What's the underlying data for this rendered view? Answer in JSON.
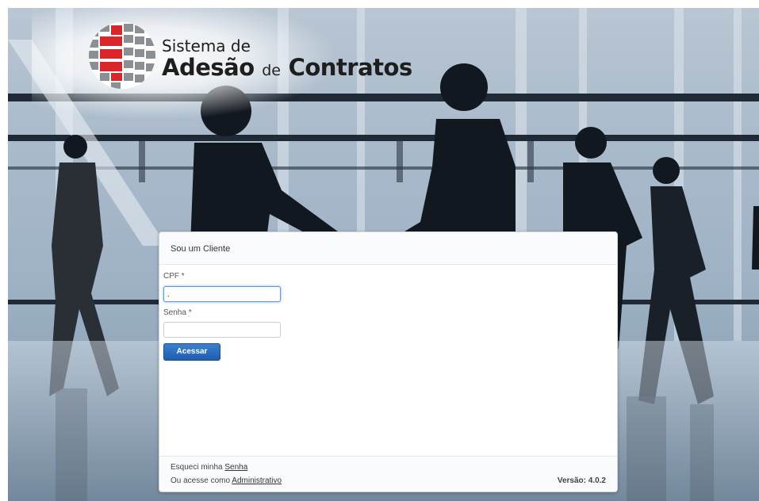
{
  "colors": {
    "primary_button": "#1d5fae",
    "focus_ring": "#5b9dd9"
  },
  "background": {
    "image": "business-people-handshake-photo"
  },
  "logo": {
    "icon": "globe-grid-icon",
    "line1": "Sistema de",
    "line2_a": "Adesão",
    "line2_b": "de",
    "line2_c": "Contratos"
  },
  "login": {
    "title": "Sou um Cliente",
    "cpf_label": "CPF *",
    "cpf_value": ".",
    "password_label": "Senha *",
    "password_value": "",
    "submit_label": "Acessar"
  },
  "footer": {
    "forgot_text": "Esqueci minha",
    "forgot_link": "Senha",
    "admin_text": "Ou acesse como",
    "admin_link": "Administrativo",
    "version": "Versão: 4.0.2"
  }
}
